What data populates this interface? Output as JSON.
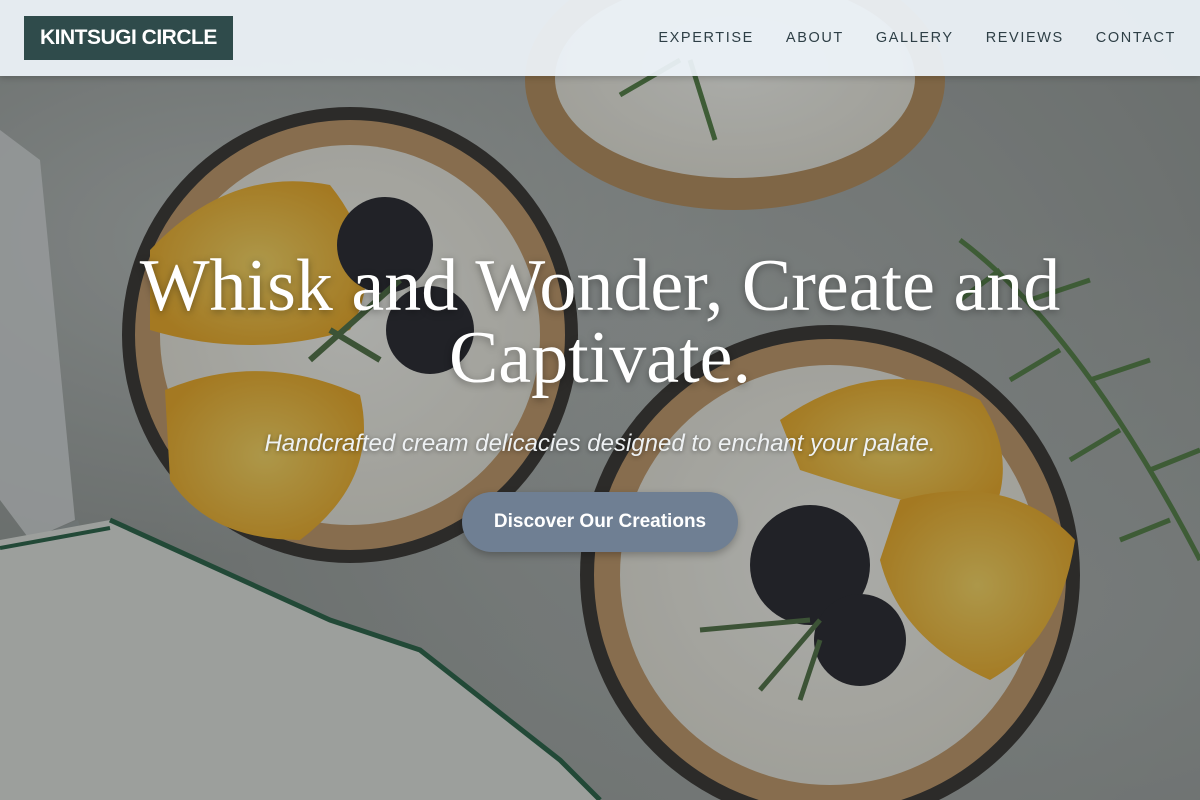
{
  "site": {
    "logo_text": "KINTSUGI CIRCLE"
  },
  "nav": {
    "items": [
      {
        "label": "EXPERTISE"
      },
      {
        "label": "ABOUT"
      },
      {
        "label": "GALLERY"
      },
      {
        "label": "REVIEWS"
      },
      {
        "label": "CONTACT"
      }
    ]
  },
  "hero": {
    "title": "Whisk and Wonder, Create and Captivate.",
    "subtitle": "Handcrafted cream delicacies designed to enchant your palate.",
    "cta_label": "Discover Our Creations",
    "background_image": "cream-tarts-orange-blackberry-photo"
  },
  "colors": {
    "logo_bg": "#2f4b4b",
    "header_bg": "#eef4fa",
    "nav_text": "#2e3f46",
    "cta_bg": "#6f7f93",
    "hero_text": "#ffffff"
  }
}
